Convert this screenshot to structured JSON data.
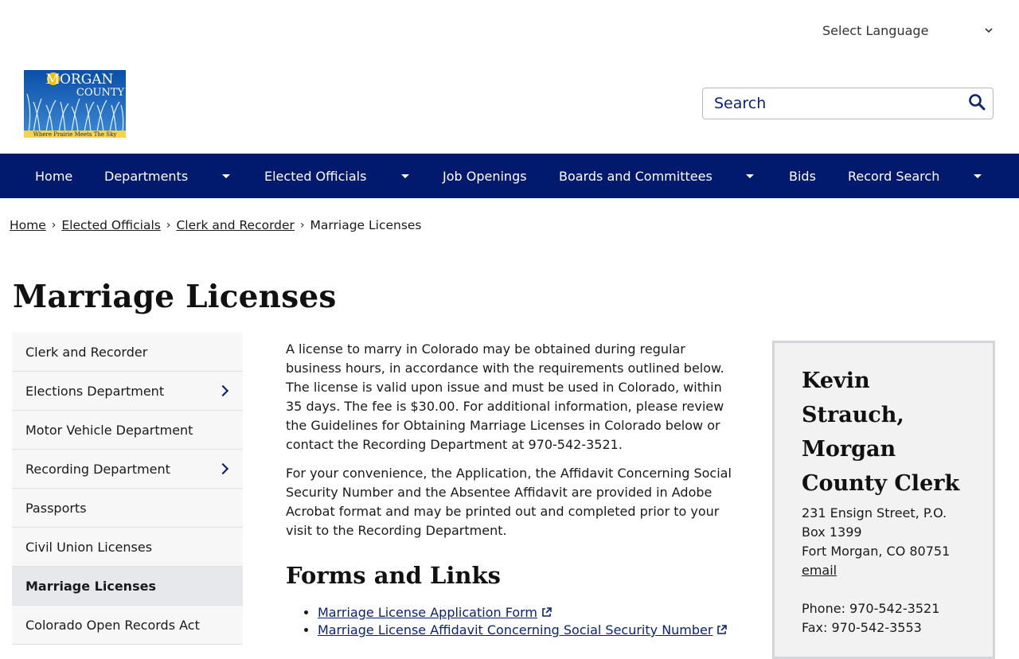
{
  "language": {
    "label": "Select Language"
  },
  "logo": {
    "title_top": "MORGAN",
    "title_bottom": "COUNTY",
    "tagline": "Where Prairie Meets The Sky"
  },
  "search": {
    "placeholder": "Search"
  },
  "nav": {
    "home": "Home",
    "departments": "Departments",
    "elected_officials": "Elected Officials",
    "job_openings": "Job Openings",
    "boards": "Boards and Committees",
    "bids": "Bids",
    "record_search": "Record Search"
  },
  "breadcrumb": {
    "home": "Home",
    "elected": "Elected Officials",
    "clerk": "Clerk and Recorder",
    "current": "Marriage Licenses",
    "separator": "›"
  },
  "page_title": "Marriage Licenses",
  "sidebar": {
    "items": [
      {
        "label": "Clerk and Recorder"
      },
      {
        "label": "Elections Department"
      },
      {
        "label": "Motor Vehicle Department"
      },
      {
        "label": "Recording Department"
      },
      {
        "label": "Passports"
      },
      {
        "label": "Civil Union Licenses"
      },
      {
        "label": "Marriage Licenses"
      },
      {
        "label": "Colorado Open Records Act"
      }
    ]
  },
  "content": {
    "para1": "A license to marry in Colorado may be obtained during regular business hours, in accordance with the requirements outlined below. The license is valid upon issue and must be used in Colorado, within 35 days. The fee is $30.00. For additional information, please review the Guidelines for Obtaining Marriage Licenses in Colorado below or contact the Recording Department at 970-542-3521.",
    "para2": "For your convenience, the Application, the Affidavit Concerning Social Security Number and the Absentee Affidavit are provided in Adobe Acrobat format and may be printed out and completed prior to your visit to the Recording Department.",
    "forms_heading": "Forms and Links",
    "links": [
      "Marriage License Application Form",
      "Marriage License Affidavit Concerning Social Security Number"
    ]
  },
  "contact_card": {
    "name": "Kevin Strauch, Morgan County Clerk",
    "address1": "231 Ensign Street, P.O. Box 1399",
    "address2": "Fort Morgan, CO 80751",
    "email_label": "email",
    "phone": "Phone: 970-542-3521",
    "fax": "Fax: 970-542-3553"
  },
  "colors": {
    "nav_bg": "#021a6e",
    "link": "#0a2472",
    "sidebar_active": "#e6e8ec",
    "card_bg": "#f2f2f2"
  }
}
